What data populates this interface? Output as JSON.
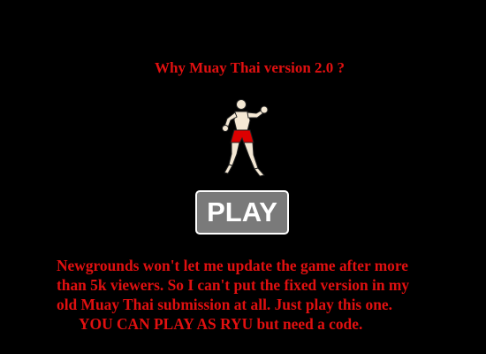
{
  "title": "Why Muay Thai version 2.0 ?",
  "play_button": {
    "label": "PLAY"
  },
  "message_lines": [
    "Newgrounds won't let me update the game after more",
    "than 5k viewers. So I can't put the fixed version in my",
    "old Muay Thai submission at all. Just play this one.",
    "YOU CAN PLAY AS RYU but need a code."
  ],
  "colors": {
    "background": "#000000",
    "text_red": "#e01010",
    "button_fill": "#7a7a7a",
    "button_text": "#ffffff",
    "shorts_red": "#dd0000"
  },
  "icons": {
    "fighter": "muay-thai-fighter-figure"
  }
}
